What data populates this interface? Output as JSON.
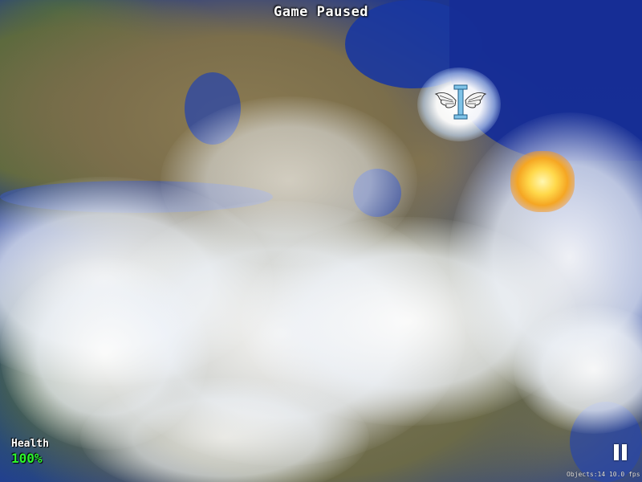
{
  "game": {
    "status_text": "Game Paused",
    "health_label": "Health",
    "health_value": "100%",
    "stats_text": "Objects:14  10.0 fps"
  },
  "controls": {
    "pause_icon": "pause-icon"
  },
  "sprites": {
    "player": "winged-i-ship",
    "effect": "fireball-explosion"
  },
  "colors": {
    "health_value": "#2df52d",
    "status_text": "#ffffff"
  }
}
